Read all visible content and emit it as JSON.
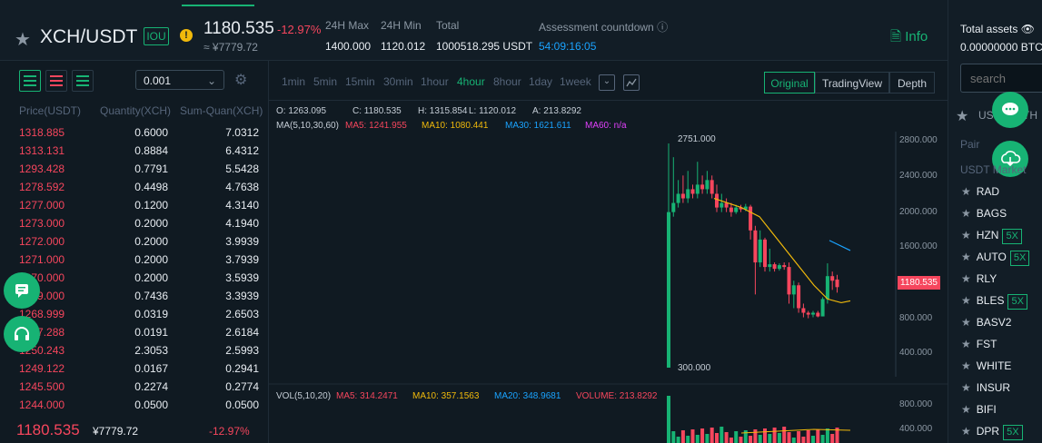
{
  "header": {
    "pair": "XCH/USDT",
    "tag": "IOU",
    "warn_glyph": "!",
    "price": "1180.535",
    "change": "-12.97%",
    "price_cny": "≈ ¥7779.72",
    "stats": [
      {
        "label": "24H Max",
        "value": "1400.000"
      },
      {
        "label": "24H Min",
        "value": "1120.012"
      },
      {
        "label": "Total",
        "value": "1000518.295 USDT"
      }
    ],
    "countdown_label": "Assessment countdown",
    "countdown_value": "54:09:16:05",
    "info_label": "Info"
  },
  "orderbook": {
    "depth": "0.001",
    "columns": [
      "Price(USDT)",
      "Quantity(XCH)",
      "Sum-Quan(XCH)"
    ],
    "asks": [
      [
        "1318.885",
        "0.6000",
        "7.0312"
      ],
      [
        "1313.131",
        "0.8884",
        "6.4312"
      ],
      [
        "1293.428",
        "0.7791",
        "5.5428"
      ],
      [
        "1278.592",
        "0.4498",
        "4.7638"
      ],
      [
        "1277.000",
        "0.1200",
        "4.3140"
      ],
      [
        "1273.000",
        "0.2000",
        "4.1940"
      ],
      [
        "1272.000",
        "0.2000",
        "3.9939"
      ],
      [
        "1271.000",
        "0.2000",
        "3.7939"
      ],
      [
        "1270.000",
        "0.2000",
        "3.5939"
      ],
      [
        "1269.000",
        "0.7436",
        "3.3939"
      ],
      [
        "1268.999",
        "0.0319",
        "2.6503"
      ],
      [
        "1257.288",
        "0.0191",
        "2.6184"
      ],
      [
        "1250.243",
        "2.3053",
        "2.5993"
      ],
      [
        "1249.122",
        "0.0167",
        "0.2941"
      ],
      [
        "1245.500",
        "0.2274",
        "0.2774"
      ],
      [
        "1244.000",
        "0.0500",
        "0.0500"
      ]
    ],
    "last_price": "1180.535",
    "last_cny": "¥7779.72",
    "last_change": "-12.97%"
  },
  "chart": {
    "timeframes": [
      "1min",
      "5min",
      "15min",
      "30min",
      "1hour",
      "4hour",
      "8hour",
      "1day",
      "1week"
    ],
    "active_timeframe": "4hour",
    "tabs": [
      "Original",
      "TradingView",
      "Depth"
    ],
    "active_tab": "Original",
    "ohlc": {
      "O": "O: 1263.095",
      "C": "C: 1180.535",
      "H": "H: 1315.854",
      "L": "L: 1120.012",
      "A": "A: 213.8292"
    },
    "ma_label": "MA(5,10,30,60)",
    "ma5": "MA5: 1241.955",
    "ma10": "MA10: 1080.441",
    "ma30": "MA30: 1621.611",
    "ma60": "MA60: n/a",
    "high_marker": "2751.000",
    "low_marker": "300.000",
    "price_tag": "1180.535",
    "price_axis": [
      "2800.000",
      "2400.000",
      "2000.000",
      "1600.000",
      "800.000",
      "400.000"
    ],
    "vol_label": "VOL(5,10,20)",
    "vol_ma5": "MA5: 314.2471",
    "vol_ma10": "MA10: 357.1563",
    "vol_ma20": "MA20: 348.9681",
    "vol_volume": "VOLUME: 213.8292",
    "vol_axis": [
      "800.000",
      "400.000"
    ],
    "colors": {
      "up": "#17b374",
      "down": "#f6465d",
      "ma5": "#f6465d",
      "ma10": "#f0b90b",
      "ma30": "#1aa3ff",
      "ma60": "#e040fb"
    }
  },
  "sidebar": {
    "total_label": "Total assets",
    "total_value": "0.00000000 BTC",
    "search_placeholder": "search",
    "tab_label": "USDT",
    "tab_label2": "ETH",
    "pair_col": "Pair",
    "market_label": "USDT Market",
    "markets": [
      {
        "name": "RAD",
        "badge": ""
      },
      {
        "name": "BAGS",
        "badge": ""
      },
      {
        "name": "HZN",
        "badge": "5X"
      },
      {
        "name": "AUTO",
        "badge": "5X"
      },
      {
        "name": "RLY",
        "badge": ""
      },
      {
        "name": "BLES",
        "badge": "5X"
      },
      {
        "name": "BASV2",
        "badge": ""
      },
      {
        "name": "FST",
        "badge": ""
      },
      {
        "name": "WHITE",
        "badge": ""
      },
      {
        "name": "INSUR",
        "badge": ""
      },
      {
        "name": "BIFI",
        "badge": ""
      },
      {
        "name": "DPR",
        "badge": "5X"
      }
    ]
  },
  "candles": [
    [
      0,
      300,
      2000,
      300,
      2751,
      "up"
    ],
    [
      1,
      2000,
      2100,
      1950,
      2600,
      "up"
    ],
    [
      2,
      2100,
      2200,
      2050,
      2350,
      "up"
    ],
    [
      3,
      2200,
      2150,
      2100,
      2400,
      "down"
    ],
    [
      4,
      2150,
      2250,
      2100,
      2450,
      "up"
    ],
    [
      5,
      2250,
      2200,
      2150,
      2300,
      "down"
    ],
    [
      6,
      2200,
      2300,
      2150,
      2550,
      "up"
    ],
    [
      7,
      2300,
      2250,
      2200,
      2400,
      "down"
    ],
    [
      8,
      2250,
      2350,
      2200,
      2450,
      "up"
    ],
    [
      9,
      2350,
      2200,
      2150,
      2400,
      "down"
    ],
    [
      10,
      2200,
      2050,
      2000,
      2300,
      "down"
    ],
    [
      11,
      2050,
      2100,
      2000,
      2200,
      "up"
    ],
    [
      12,
      2100,
      2050,
      2000,
      2150,
      "down"
    ],
    [
      13,
      2050,
      2000,
      1950,
      2100,
      "down"
    ],
    [
      14,
      2000,
      2050,
      1980,
      2080,
      "up"
    ],
    [
      15,
      2050,
      2030,
      2000,
      2080,
      "down"
    ],
    [
      16,
      2030,
      2060,
      2010,
      2090,
      "up"
    ],
    [
      17,
      2060,
      1800,
      1700,
      2080,
      "down"
    ],
    [
      18,
      1800,
      1450,
      1100,
      1850,
      "down"
    ],
    [
      19,
      1450,
      1700,
      1400,
      1800,
      "up"
    ],
    [
      20,
      1700,
      1400,
      1350,
      1720,
      "down"
    ],
    [
      21,
      1400,
      1430,
      1350,
      1600,
      "up"
    ],
    [
      22,
      1430,
      1380,
      1350,
      1450,
      "down"
    ],
    [
      23,
      1380,
      1420,
      1360,
      1440,
      "up"
    ],
    [
      24,
      1420,
      1400,
      1370,
      1450,
      "down"
    ],
    [
      25,
      1400,
      1100,
      1000,
      1450,
      "down"
    ],
    [
      26,
      1100,
      1200,
      950,
      1250,
      "up"
    ],
    [
      27,
      1200,
      950,
      900,
      1230,
      "down"
    ],
    [
      28,
      950,
      900,
      850,
      1000,
      "down"
    ],
    [
      29,
      900,
      880,
      840,
      920,
      "down"
    ],
    [
      30,
      880,
      900,
      850,
      920,
      "up"
    ],
    [
      31,
      900,
      860,
      850,
      920,
      "down"
    ],
    [
      32,
      860,
      1050,
      860,
      1070,
      "up"
    ],
    [
      33,
      1050,
      1300,
      1000,
      1440,
      "up"
    ],
    [
      34,
      1300,
      1250,
      1150,
      1350,
      "down"
    ],
    [
      35,
      1263,
      1180,
      1120,
      1315,
      "down"
    ]
  ]
}
